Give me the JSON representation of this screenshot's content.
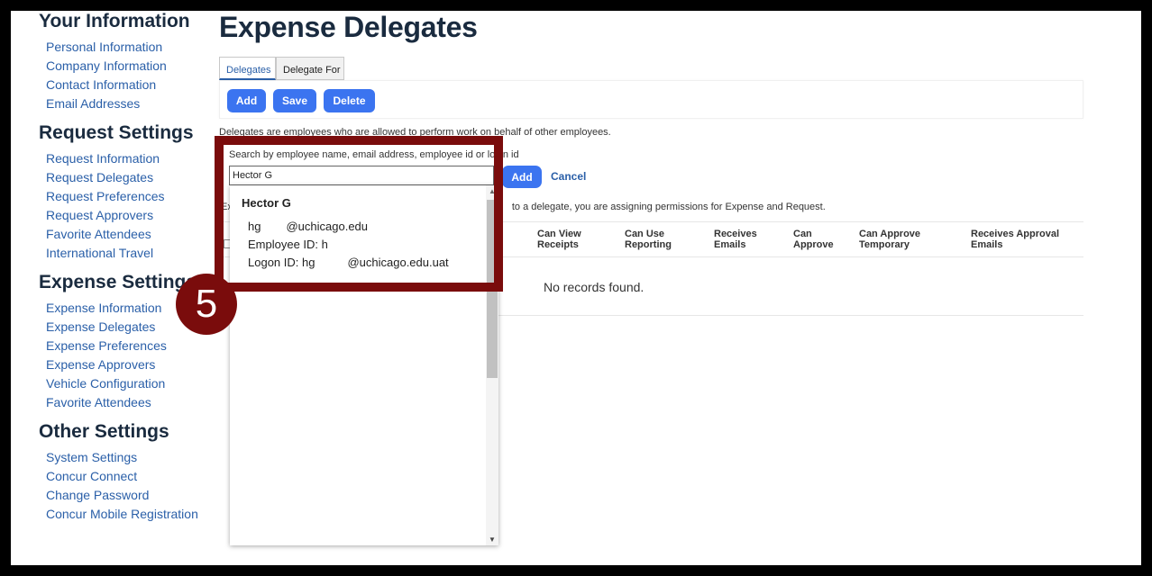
{
  "page": {
    "title": "Expense Delegates",
    "description": "Delegates are employees who are allowed to perform work on behalf of other employees.",
    "assign_text_left": "Ex",
    "assign_text_right": "to a delegate, you are assigning permissions for Expense and Request."
  },
  "sidebar": {
    "sections": [
      {
        "title": "Your Information",
        "items": [
          "Personal Information",
          "Company Information",
          "Contact Information",
          "Email Addresses"
        ]
      },
      {
        "title": "Request Settings",
        "items": [
          "Request Information",
          "Request Delegates",
          "Request Preferences",
          "Request Approvers",
          "Favorite Attendees",
          "International Travel"
        ]
      },
      {
        "title": "Expense Settings",
        "items": [
          "Expense Information",
          "Expense Delegates",
          "Expense Preferences",
          "Expense Approvers",
          "Vehicle Configuration",
          "Favorite Attendees"
        ]
      },
      {
        "title": "Other Settings",
        "items": [
          "System Settings",
          "Concur Connect",
          "Change Password",
          "Concur Mobile Registration"
        ]
      }
    ]
  },
  "tabs": {
    "delegates": "Delegates",
    "delegate_for": "Delegate For"
  },
  "toolbar": {
    "add": "Add",
    "save": "Save",
    "delete": "Delete"
  },
  "search": {
    "label": "Search by employee name, email address, employee id or login id",
    "value": "Hector G",
    "add": "Add",
    "cancel": "Cancel"
  },
  "table": {
    "columns": [
      "Can View Receipts",
      "Can Use Reporting",
      "Receives Emails",
      "Can Approve",
      "Can Approve Temporary",
      "Receives Approval Emails"
    ],
    "empty_text": "No records found."
  },
  "dropdown": {
    "name": "Hector G",
    "email_user": "hg",
    "email_domain": "@uchicago.edu",
    "employee_id": "Employee ID: h",
    "logon_prefix": "Logon ID: hg",
    "logon_domain": "@uchicago.edu.uat"
  },
  "callout": {
    "step": "5",
    "color": "#7a0c0c"
  },
  "colors": {
    "accent": "#3b74f0",
    "link": "#2a5fa8",
    "heading": "#1a2b3f"
  }
}
